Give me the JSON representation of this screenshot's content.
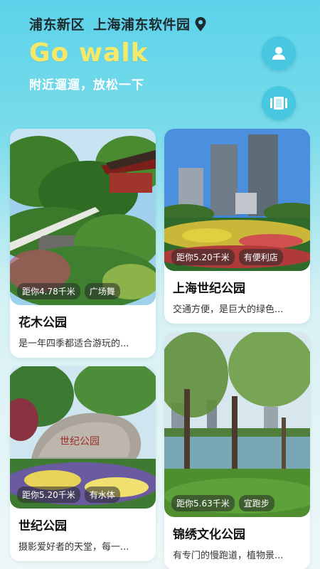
{
  "header": {
    "district": "浦东新区",
    "place": "上海浦东软件园",
    "brand": "Go walk",
    "subtitle": "附近遛遛，放松一下",
    "icons": {
      "location": "location-pin-icon",
      "user": "user-icon",
      "card": "card-icon"
    }
  },
  "parks_left": [
    {
      "name": "花木公园",
      "distance": "距你4.78千米",
      "feature": "广场舞",
      "desc": "是一年四季都适合游玩的..."
    },
    {
      "name": "世纪公园",
      "distance": "距你5.20千米",
      "feature": "有水体",
      "desc": "摄影爱好者的天堂，每一..."
    }
  ],
  "parks_right": [
    {
      "name": "上海世纪公园",
      "distance": "距你5.20千米",
      "feature": "有便利店",
      "desc": "交通方便，是巨大的绿色..."
    },
    {
      "name": "锦绣文化公园",
      "distance": "距你5.63千米",
      "feature": "宜跑步",
      "desc": "有专门的慢跑道，植物景..."
    }
  ],
  "colors": {
    "accent": "#47c8e0",
    "brand_yellow": "#f6e96a",
    "tag_bg": "#3a3a3a"
  }
}
